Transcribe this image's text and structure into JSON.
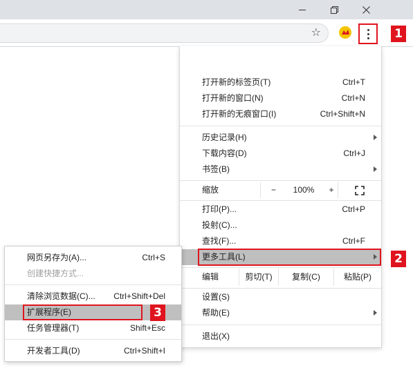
{
  "window": {
    "minimize_icon": "minimize-icon",
    "restore_icon": "restore-icon",
    "close_icon": "close-icon"
  },
  "toolbar": {
    "bookmark_icon": "star-icon",
    "extension_icon": "extension-icon",
    "menu_icon": "vertical-dots-icon"
  },
  "badges": {
    "one": "1",
    "two": "2",
    "three": "3"
  },
  "menu": {
    "new_tab": "打开新的标签页(T)",
    "new_tab_sc": "Ctrl+T",
    "new_window": "打开新的窗口(N)",
    "new_window_sc": "Ctrl+N",
    "new_incognito": "打开新的无痕窗口(I)",
    "new_incognito_sc": "Ctrl+Shift+N",
    "history": "历史记录(H)",
    "downloads": "下载内容(D)",
    "downloads_sc": "Ctrl+J",
    "bookmarks": "书签(B)",
    "zoom_label": "缩放",
    "zoom_minus": "−",
    "zoom_value": "100%",
    "zoom_plus": "+",
    "print": "打印(P)...",
    "print_sc": "Ctrl+P",
    "cast": "投射(C)...",
    "find": "查找(F)...",
    "find_sc": "Ctrl+F",
    "more_tools": "更多工具(L)",
    "edit_label": "编辑",
    "cut": "剪切(T)",
    "copy": "复制(C)",
    "paste": "粘贴(P)",
    "settings": "设置(S)",
    "help": "帮助(E)",
    "exit": "退出(X)"
  },
  "submenu": {
    "save_page": "网页另存为(A)...",
    "save_page_sc": "Ctrl+S",
    "create_shortcut": "创建快捷方式...",
    "clear_data": "清除浏览数据(C)...",
    "clear_data_sc": "Ctrl+Shift+Del",
    "extensions": "扩展程序(E)",
    "task_manager": "任务管理器(T)",
    "task_manager_sc": "Shift+Esc",
    "dev_tools": "开发者工具(D)",
    "dev_tools_sc": "Ctrl+Shift+I"
  },
  "colors": {
    "highlight": "#e0141e",
    "hover_bg": "#bfbfbf"
  }
}
